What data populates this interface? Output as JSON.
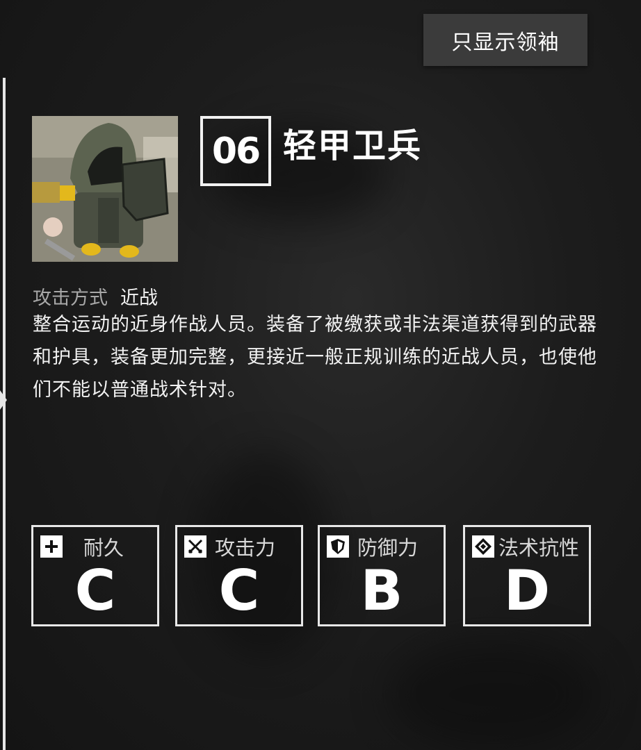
{
  "header": {
    "leader_button": "只显示领袖"
  },
  "enemy": {
    "number": "06",
    "name": "轻甲卫兵",
    "attack_label": "攻击方式",
    "attack_value": "近战",
    "description": "整合运动的近身作战人员。装备了被缴获或非法渠道获得到的武器和护具，装备更加完整，更接近一般正规训练的近战人员，也使他们不能以普通战术针对。"
  },
  "stats": [
    {
      "label": "耐久",
      "grade": "C",
      "icon": "plus-icon"
    },
    {
      "label": "攻击力",
      "grade": "C",
      "icon": "crossed-swords-icon"
    },
    {
      "label": "防御力",
      "grade": "B",
      "icon": "shield-icon"
    },
    {
      "label": "法术抗性",
      "grade": "D",
      "icon": "diamond-icon"
    }
  ]
}
